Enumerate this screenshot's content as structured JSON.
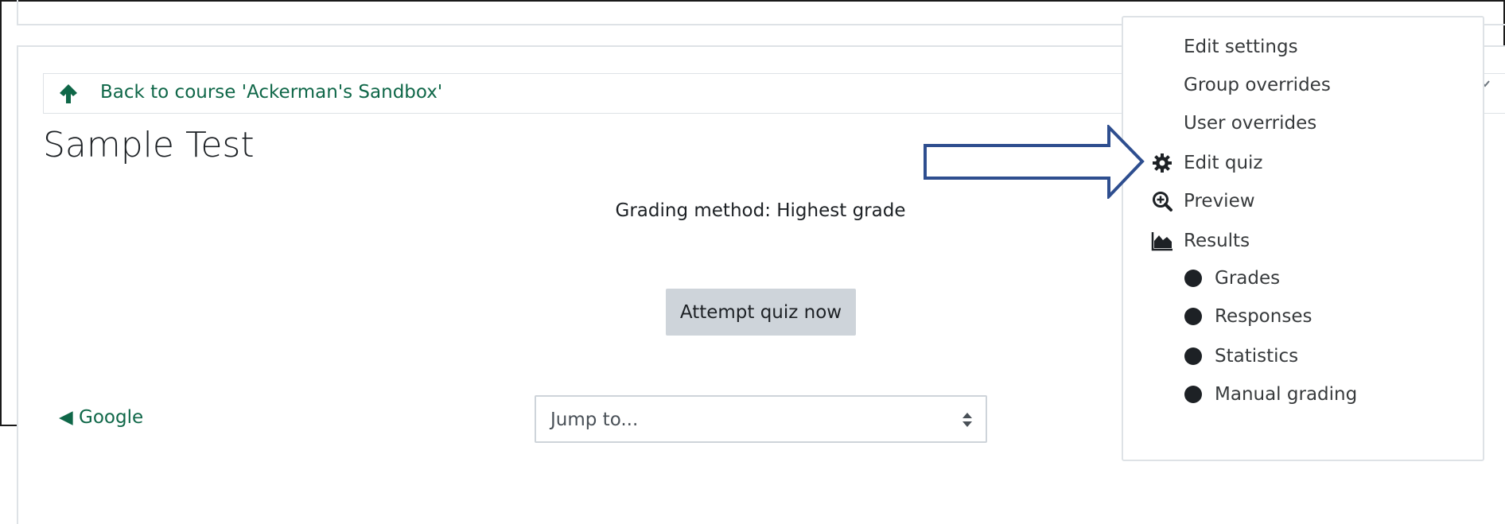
{
  "course_nav": {
    "back_label": "Back to course 'Ackerman's Sandbox'"
  },
  "page": {
    "title": "Sample Test",
    "grading_method": "Grading method: Highest grade"
  },
  "actions": {
    "attempt_label": "Attempt quiz now"
  },
  "activity_nav": {
    "prev_link": "◀ Google",
    "jump_placeholder": "Jump to..."
  },
  "admin_menu": {
    "items": [
      {
        "label": "Edit settings",
        "icon": ""
      },
      {
        "label": "Group overrides",
        "icon": ""
      },
      {
        "label": "User overrides",
        "icon": ""
      },
      {
        "label": "Edit quiz",
        "icon": "gear-icon"
      },
      {
        "label": "Preview",
        "icon": "zoom-in-icon"
      },
      {
        "label": "Results",
        "icon": "area-chart-icon"
      }
    ],
    "results_subitems": [
      {
        "label": "Grades"
      },
      {
        "label": "Responses"
      },
      {
        "label": "Statistics"
      },
      {
        "label": "Manual grading"
      }
    ]
  },
  "colors": {
    "link_green": "#0f6748",
    "callout_blue": "#2e4e8f",
    "button_gray": "#ced4da"
  }
}
